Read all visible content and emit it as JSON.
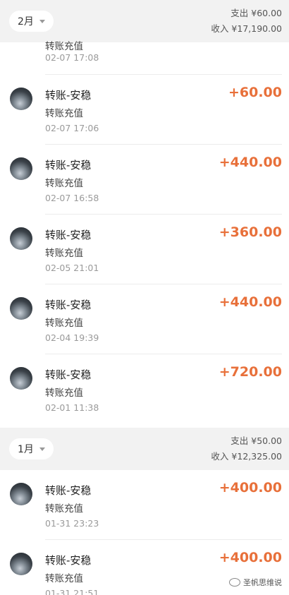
{
  "months": [
    {
      "label": "2月",
      "expense_label": "支出",
      "expense": "¥60.00",
      "income_label": "收入",
      "income": "¥17,190.00"
    },
    {
      "label": "1月",
      "expense_label": "支出",
      "expense": "¥50.00",
      "income_label": "收入",
      "income": "¥12,325.00"
    }
  ],
  "partial_item": {
    "subtitle": "转账充值",
    "time": "02-07  17:08"
  },
  "transactions_feb": [
    {
      "title": "转账-安稳",
      "subtitle": "转账充值",
      "time": "02-07  17:06",
      "amount": "+60.00"
    },
    {
      "title": "转账-安稳",
      "subtitle": "转账充值",
      "time": "02-07  16:58",
      "amount": "+440.00"
    },
    {
      "title": "转账-安稳",
      "subtitle": "转账充值",
      "time": "02-05  21:01",
      "amount": "+360.00"
    },
    {
      "title": "转账-安稳",
      "subtitle": "转账充值",
      "time": "02-04  19:39",
      "amount": "+440.00"
    },
    {
      "title": "转账-安稳",
      "subtitle": "转账充值",
      "time": "02-01  11:38",
      "amount": "+720.00"
    }
  ],
  "transactions_jan": [
    {
      "title": "转账-安稳",
      "subtitle": "转账充值",
      "time": "01-31  23:23",
      "amount": "+400.00"
    },
    {
      "title": "转账-安稳",
      "subtitle": "转账充值",
      "time": "01-31  21:51",
      "amount": "+400.00"
    }
  ],
  "watermark": {
    "text": "圣帆思维说"
  },
  "colors": {
    "income_amount": "#e8703a",
    "header_bg": "#f2f2f2"
  }
}
